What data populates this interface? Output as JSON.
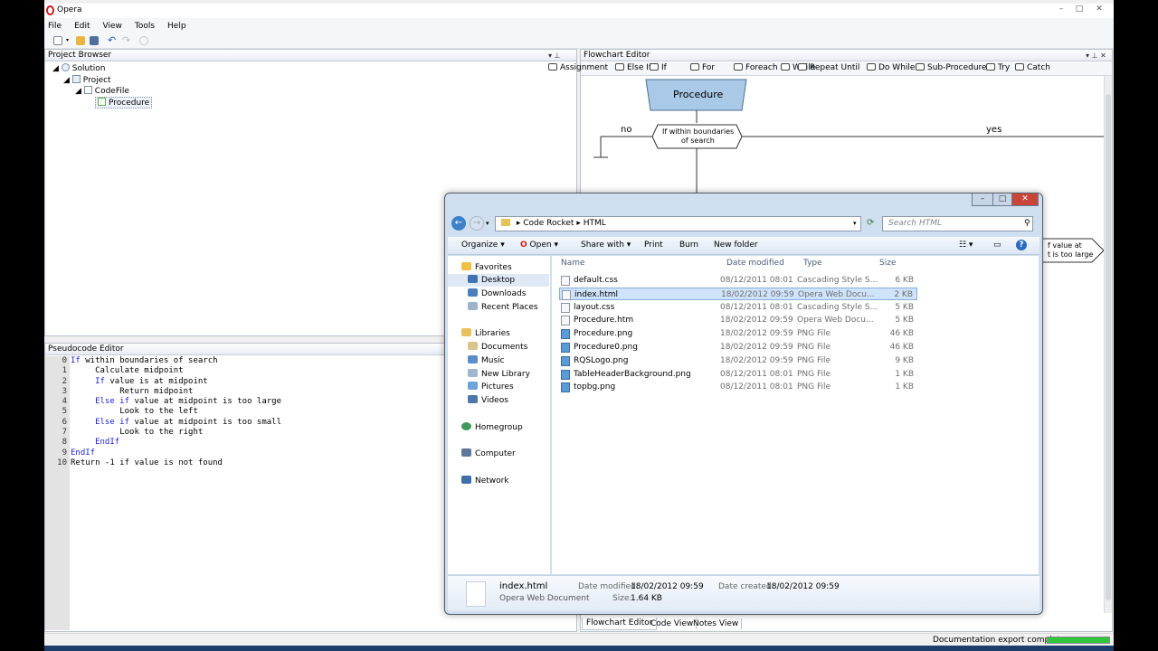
{
  "app": {
    "title": "Opera",
    "menu": [
      "File",
      "Edit",
      "View",
      "Tools",
      "Help"
    ]
  },
  "project_browser": {
    "title": "Project Browser",
    "pin": "▾ ⊥",
    "tree": [
      "Solution",
      "Project",
      "CodeFile",
      "Procedure"
    ]
  },
  "pseudocode_editor": {
    "title": "Pseudocode Editor",
    "line_numbers": [
      "0",
      "1",
      "2",
      "3",
      "4",
      "5",
      "6",
      "7",
      "8",
      "9",
      "10"
    ],
    "lines": [
      {
        "kw": "If",
        "rest": " within boundaries of search",
        "indent": ""
      },
      {
        "kw": "",
        "rest": "Calculate midpoint",
        "indent": "     "
      },
      {
        "kw": "If",
        "rest": " value is at midpoint",
        "indent": "     "
      },
      {
        "kw": "",
        "rest": "Return midpoint",
        "indent": "          "
      },
      {
        "kw": "Else if",
        "rest": " value at midpoint is too large",
        "indent": "     "
      },
      {
        "kw": "",
        "rest": "Look to the left",
        "indent": "          "
      },
      {
        "kw": "Else if",
        "rest": " value at midpoint is too small",
        "indent": "     "
      },
      {
        "kw": "",
        "rest": "Look to the right",
        "indent": "          "
      },
      {
        "kw": "EndIf",
        "rest": "",
        "indent": "     "
      },
      {
        "kw": "EndIf",
        "rest": "",
        "indent": ""
      },
      {
        "kw": "",
        "rest": "Return -1 if value is not found",
        "indent": ""
      }
    ]
  },
  "flowchart_editor": {
    "title": "Flowchart Editor",
    "tools": [
      "Assignment",
      "Else If",
      "If",
      "For",
      "Foreach",
      "While",
      "Repeat Until",
      "Do While",
      "Sub-Procedure",
      "Try",
      "Catch"
    ],
    "procedure_label": "Procedure",
    "decision_label_1": "If within boundaries",
    "decision_label_2": "of search",
    "branch_no": "no",
    "branch_yes": "yes",
    "partial_label_1": "f value at",
    "partial_label_2": "t is too large",
    "tabs": [
      "Flowchart Editor",
      "Code View",
      "Notes View"
    ]
  },
  "status": {
    "text": "Documentation export complete",
    "progress": 1.0
  },
  "explorer": {
    "breadcrumb": [
      "Code Rocket",
      "HTML"
    ],
    "search_placeholder": "Search HTML",
    "commands": [
      "Organize",
      "Open",
      "Share with",
      "Print",
      "Burn",
      "New folder"
    ],
    "nav": {
      "favorites": "Favorites",
      "favorites_items": [
        "Desktop",
        "Downloads",
        "Recent Places"
      ],
      "libraries": "Libraries",
      "libraries_items": [
        "Documents",
        "Music",
        "New Library",
        "Pictures",
        "Videos"
      ],
      "homegroup": "Homegroup",
      "computer": "Computer",
      "network": "Network"
    },
    "columns": [
      "Name",
      "Date modified",
      "Type",
      "Size"
    ],
    "files": [
      {
        "name": "default.css",
        "date": "08/12/2011 08:01",
        "type": "Cascading Style S...",
        "size": "6 KB"
      },
      {
        "name": "index.html",
        "date": "18/02/2012 09:59",
        "type": "Opera Web Docu...",
        "size": "2 KB"
      },
      {
        "name": "layout.css",
        "date": "08/12/2011 08:01",
        "type": "Cascading Style S...",
        "size": "5 KB"
      },
      {
        "name": "Procedure.htm",
        "date": "18/02/2012 09:59",
        "type": "Opera Web Docu...",
        "size": "5 KB"
      },
      {
        "name": "Procedure.png",
        "date": "18/02/2012 09:59",
        "type": "PNG File",
        "size": "46 KB"
      },
      {
        "name": "Procedure0.png",
        "date": "18/02/2012 09:59",
        "type": "PNG File",
        "size": "46 KB"
      },
      {
        "name": "RQSLogo.png",
        "date": "18/02/2012 09:59",
        "type": "PNG File",
        "size": "9 KB"
      },
      {
        "name": "TableHeaderBackground.png",
        "date": "08/12/2011 08:01",
        "type": "PNG File",
        "size": "1 KB"
      },
      {
        "name": "topbg.png",
        "date": "08/12/2011 08:01",
        "type": "PNG File",
        "size": "1 KB"
      }
    ],
    "selected_index": 1,
    "detail": {
      "name": "index.html",
      "type": "Opera Web Document",
      "modified_label": "Date modified:",
      "modified": "18/02/2012 09:59",
      "created_label": "Date created:",
      "created": "18/02/2012 09:59",
      "size_label": "Size:",
      "size": "1.64 KB"
    }
  }
}
